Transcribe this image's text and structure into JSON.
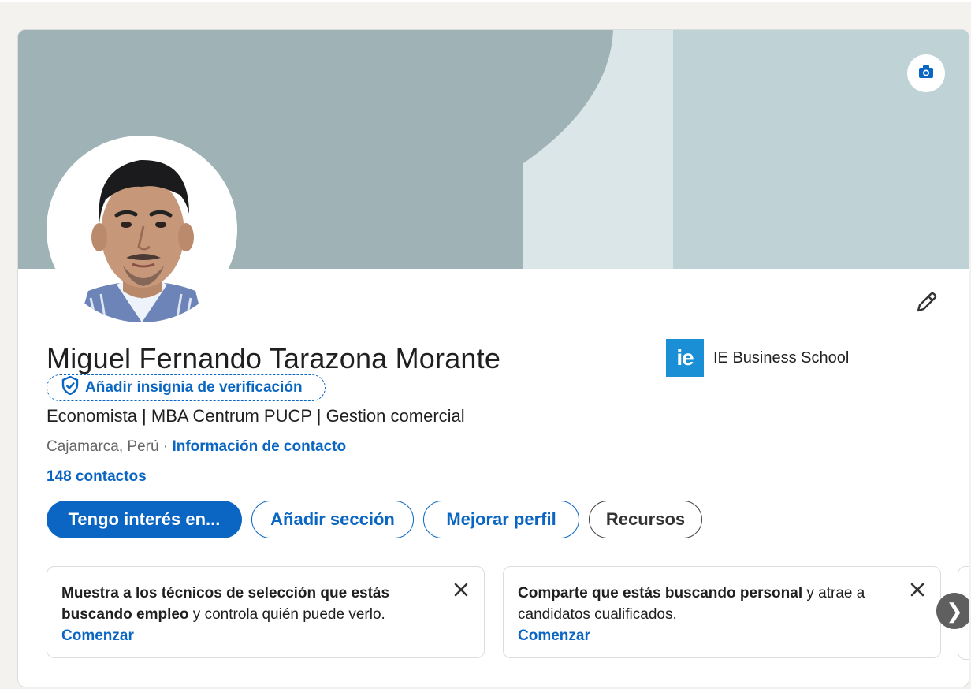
{
  "profile": {
    "name": "Miguel Fernando Tarazona Morante",
    "verify_label": "Añadir insignia de verificación",
    "headline": "Economista | MBA Centrum PUCP | Gestion comercial",
    "location": "Cajamarca, Perú",
    "separator": " · ",
    "contact_info_label": "Información de contacto",
    "connections": "148 contactos",
    "school_logo_text": "ie",
    "school_name": "IE Business School"
  },
  "actions": {
    "open_to": "Tengo interés en...",
    "add_section": "Añadir sección",
    "enhance_profile": "Mejorar perfil",
    "resources": "Recursos"
  },
  "recommendations": [
    {
      "bold": "Muestra a los técnicos de selección que estás buscando empleo",
      "rest": " y controla quién puede verlo.",
      "cta": "Comenzar"
    },
    {
      "bold": "Comparte que estás buscando personal",
      "rest": " y atrae a candidatos cualificados.",
      "cta": "Comenzar"
    }
  ],
  "icons": {
    "camera": "camera-icon",
    "edit": "pencil-icon",
    "verify": "shield-check-icon",
    "close": "close-icon",
    "next": "chevron-right-icon"
  },
  "colors": {
    "brand_blue": "#0a66c2",
    "banner_dark": "#9fb2b6",
    "banner_light": "#bfd3d7",
    "school_logo_bg": "#1b8fd6"
  },
  "next_glyph": "❯"
}
